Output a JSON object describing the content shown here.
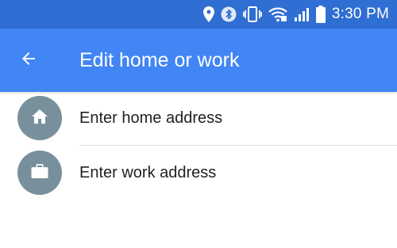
{
  "status_bar": {
    "time": "3:30 PM",
    "icons": [
      "location-icon",
      "bluetooth-icon",
      "vibrate-icon",
      "wifi-icon",
      "signal-icon",
      "battery-icon"
    ]
  },
  "app_bar": {
    "title": "Edit home or work",
    "back_icon": "arrow-back-icon"
  },
  "list": {
    "items": [
      {
        "label": "Enter home address",
        "icon": "home-icon"
      },
      {
        "label": "Enter work address",
        "icon": "briefcase-icon"
      }
    ]
  },
  "colors": {
    "status_bar": "#2f6ed2",
    "app_bar": "#4285f4",
    "avatar": "#78909c",
    "text": "#212121",
    "divider": "#e0e0e0"
  }
}
